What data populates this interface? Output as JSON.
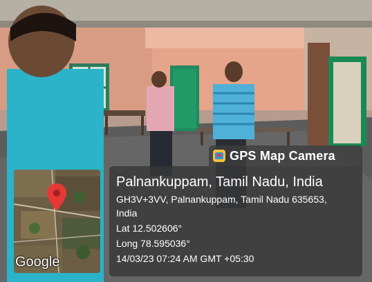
{
  "overlay": {
    "app_badge": "GPS Map Camera",
    "app_icon": "gps-map-camera-icon",
    "location_title": "Palnankuppam, Tamil Nadu, India",
    "address_line1": "GH3V+3VV, Palnankuppam, Tamil Nadu 635653,",
    "address_line2": "India",
    "lat": "Lat 12.502606°",
    "long": "Long 78.595036°",
    "datetime": "14/03/23 07:24 AM GMT +05:30",
    "map_brand": "Google",
    "pin_icon": "map-pin-icon",
    "pin_color": "#e53935"
  }
}
